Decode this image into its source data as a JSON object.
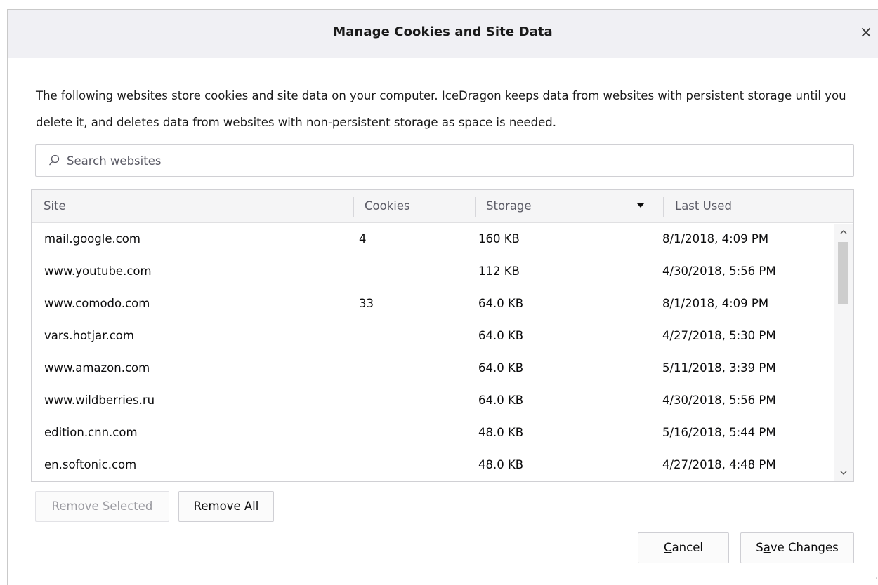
{
  "dialog": {
    "title": "Manage Cookies and Site Data",
    "close_label": "×",
    "description": "The following websites store cookies and site data on your computer. IceDragon keeps data from websites with persistent storage until you delete it, and deletes data from websites with non-persistent storage as space is needed."
  },
  "search": {
    "placeholder": "Search websites",
    "value": ""
  },
  "table": {
    "columns": [
      "Site",
      "Cookies",
      "Storage",
      "Last Used"
    ],
    "sorted_column": "Storage",
    "sort_direction": "descending",
    "rows": [
      {
        "site": "mail.google.com",
        "cookies": "4",
        "storage": "160 KB",
        "last_used": "8/1/2018, 4:09 PM"
      },
      {
        "site": "www.youtube.com",
        "cookies": "",
        "storage": "112 KB",
        "last_used": "4/30/2018, 5:56 PM"
      },
      {
        "site": "www.comodo.com",
        "cookies": "33",
        "storage": "64.0 KB",
        "last_used": "8/1/2018, 4:09 PM"
      },
      {
        "site": "vars.hotjar.com",
        "cookies": "",
        "storage": "64.0 KB",
        "last_used": "4/27/2018, 5:30 PM"
      },
      {
        "site": "www.amazon.com",
        "cookies": "",
        "storage": "64.0 KB",
        "last_used": "5/11/2018, 3:39 PM"
      },
      {
        "site": "www.wildberries.ru",
        "cookies": "",
        "storage": "64.0 KB",
        "last_used": "4/30/2018, 5:56 PM"
      },
      {
        "site": "edition.cnn.com",
        "cookies": "",
        "storage": "48.0 KB",
        "last_used": "5/16/2018, 5:44 PM"
      },
      {
        "site": "en.softonic.com",
        "cookies": "",
        "storage": "48.0 KB",
        "last_used": "4/27/2018, 4:48 PM"
      }
    ]
  },
  "buttons": {
    "remove_selected": {
      "mnemonic": "R",
      "rest": "emove Selected",
      "enabled": false
    },
    "remove_all": {
      "pre": "R",
      "mnemonic": "e",
      "rest": "move All",
      "enabled": true
    },
    "cancel": {
      "mnemonic": "C",
      "rest": "ancel"
    },
    "save": {
      "pre": "S",
      "mnemonic": "a",
      "rest": "ve Changes"
    }
  },
  "icons": {
    "search": "search-icon",
    "close": "close-icon",
    "sort": "sort-descending-icon",
    "scroll_up": "chevron-up-icon",
    "scroll_down": "chevron-down-icon"
  }
}
